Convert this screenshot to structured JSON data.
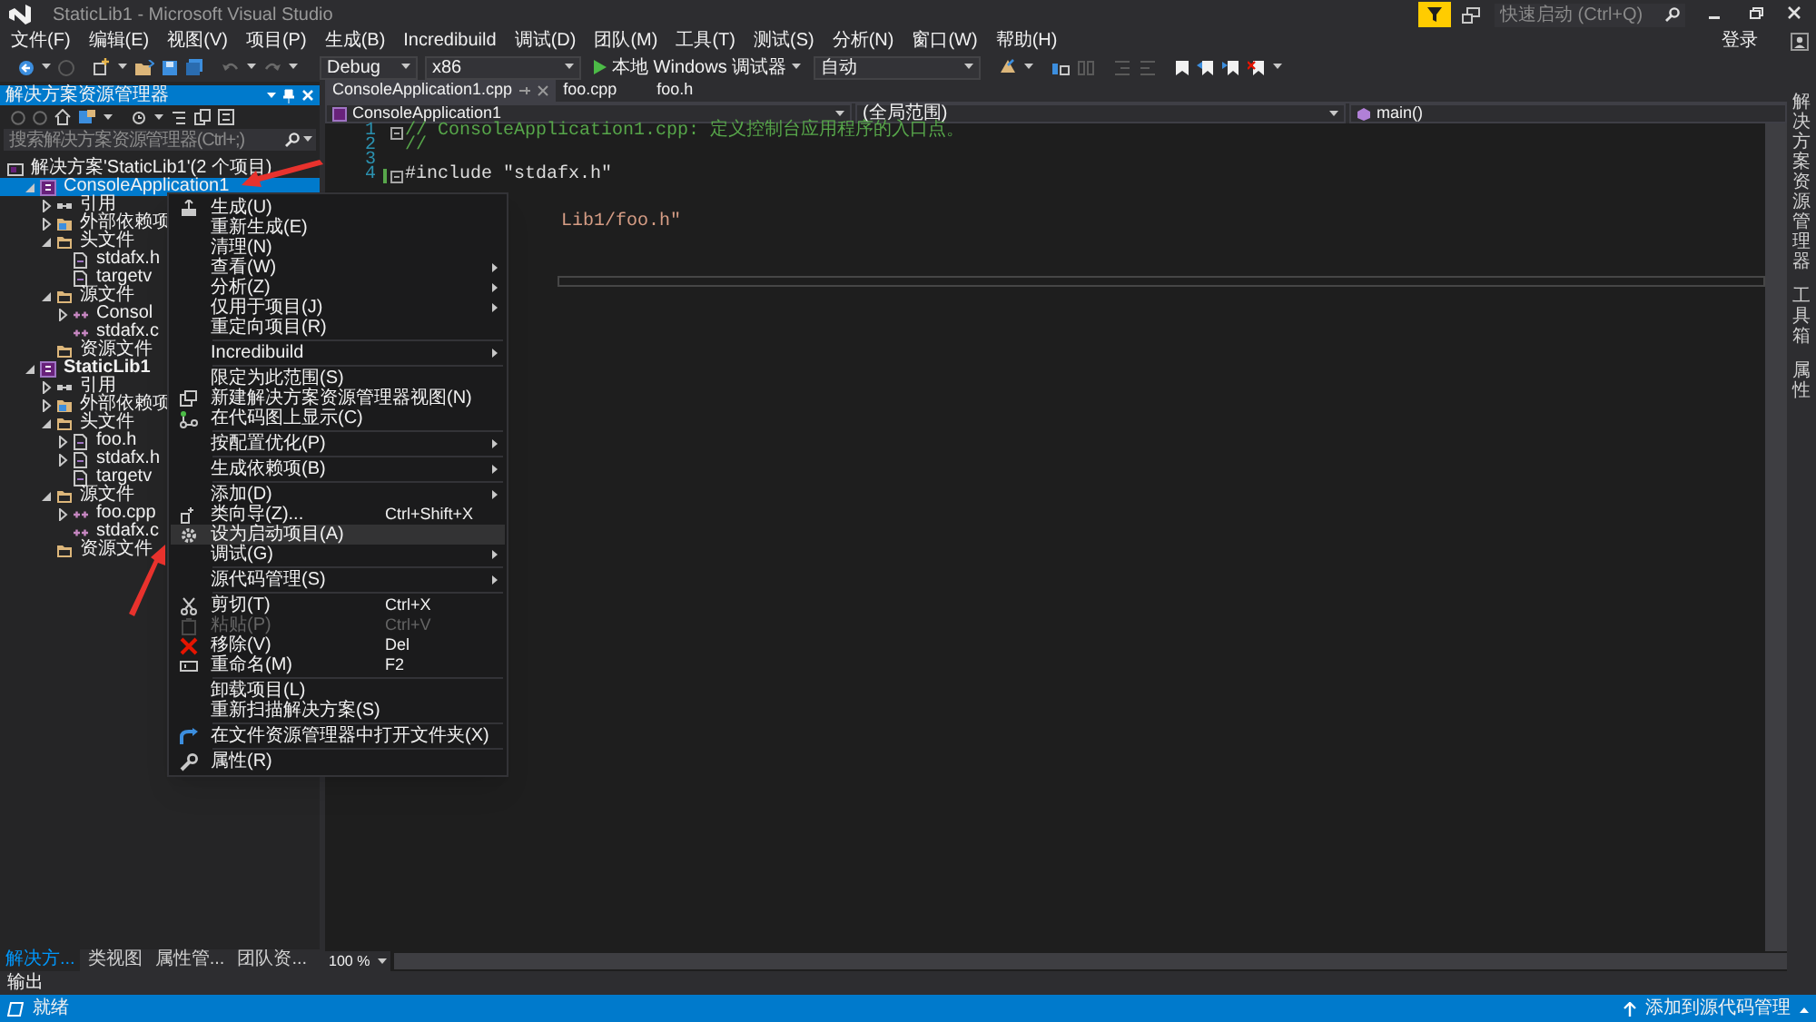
{
  "window": {
    "title": "StaticLib1 - Microsoft Visual Studio"
  },
  "quick_launch": {
    "placeholder": "快速启动 (Ctrl+Q)"
  },
  "menu_bar": [
    "文件(F)",
    "编辑(E)",
    "视图(V)",
    "项目(P)",
    "生成(B)",
    "Incredibuild",
    "调试(D)",
    "团队(M)",
    "工具(T)",
    "测试(S)",
    "分析(N)",
    "窗口(W)",
    "帮助(H)"
  ],
  "sign_in": "登录",
  "toolbar": {
    "configuration": "Debug",
    "platform": "x86",
    "run_button": "本地 Windows 调试器",
    "run_mode": "自动"
  },
  "solution_explorer": {
    "title": "解决方案资源管理器",
    "search": {
      "placeholder": "搜索解决方案资源管理器(Ctrl+;)"
    },
    "tree": [
      {
        "label": "解决方案'StaticLib1'(2 个项目)",
        "kind": "solution",
        "selected": false,
        "children": [
          {
            "label": "ConsoleApplication1",
            "kind": "project",
            "startup": false,
            "expanded": true,
            "selected": true,
            "children": [
              {
                "label": "引用",
                "kind": "references",
                "expanded": false,
                "selected": false
              },
              {
                "label": "外部依赖项",
                "kind": "dependencies",
                "expanded": false,
                "selected": false
              },
              {
                "label": "头文件",
                "kind": "folder",
                "expanded": true,
                "selected": false,
                "children": [
                  {
                    "label": "stdafx.h",
                    "kind": "header",
                    "selected": false
                  },
                  {
                    "label": "targetv",
                    "kind": "header",
                    "selected": false
                  }
                ]
              },
              {
                "label": "源文件",
                "kind": "folder",
                "expanded": true,
                "selected": false,
                "children": [
                  {
                    "label": "Consol",
                    "kind": "source",
                    "expanded": false,
                    "selected": false
                  },
                  {
                    "label": "stdafx.c",
                    "kind": "source",
                    "selected": false
                  }
                ]
              },
              {
                "label": "资源文件",
                "kind": "folder",
                "selected": false
              }
            ]
          },
          {
            "label": "StaticLib1",
            "kind": "project",
            "startup": true,
            "expanded": true,
            "selected": false,
            "children": [
              {
                "label": "引用",
                "kind": "references",
                "expanded": false,
                "selected": false
              },
              {
                "label": "外部依赖项",
                "kind": "dependencies",
                "expanded": false,
                "selected": false
              },
              {
                "label": "头文件",
                "kind": "folder",
                "expanded": true,
                "selected": false,
                "children": [
                  {
                    "label": "foo.h",
                    "kind": "header",
                    "expanded": false,
                    "selected": false
                  },
                  {
                    "label": "stdafx.h",
                    "kind": "header",
                    "expanded": false,
                    "selected": false
                  },
                  {
                    "label": "targetv",
                    "kind": "header",
                    "selected": false
                  }
                ]
              },
              {
                "label": "源文件",
                "kind": "folder",
                "expanded": true,
                "selected": false,
                "children": [
                  {
                    "label": "foo.cpp",
                    "kind": "source",
                    "expanded": false,
                    "selected": false
                  },
                  {
                    "label": "stdafx.c",
                    "kind": "source",
                    "selected": false
                  }
                ]
              },
              {
                "label": "资源文件",
                "kind": "folder",
                "selected": false
              }
            ]
          }
        ]
      }
    ],
    "bottom_tabs": [
      {
        "label": "解决方...",
        "selected": true
      },
      {
        "label": "类视图",
        "selected": false
      },
      {
        "label": "属性管...",
        "selected": false
      },
      {
        "label": "团队资...",
        "selected": false
      }
    ]
  },
  "editor": {
    "tabs": [
      {
        "label": "ConsoleApplication1.cpp",
        "selected": true
      },
      {
        "label": "foo.cpp",
        "selected": false
      },
      {
        "label": "foo.h",
        "selected": false
      }
    ],
    "nav": {
      "project": "ConsoleApplication1",
      "scope": "(全局范围)",
      "member": "main()"
    },
    "lines": [
      {
        "number": "1",
        "text": "// ConsoleApplication1.cpp: 定义控制台应用程序的入口点。",
        "kind": "comment",
        "collapsible": true,
        "changed": false
      },
      {
        "number": "2",
        "text": "//",
        "kind": "comment",
        "collapsible": false,
        "changed": false
      },
      {
        "number": "3",
        "kind": "blank",
        "collapsible": false,
        "changed": false
      },
      {
        "number": "4",
        "text": "#include \"stdafx.h\"",
        "kind": "code",
        "collapsible": true,
        "changed": true
      }
    ],
    "covered_line": {
      "text": "Lib1/foo.h\""
    },
    "zoom": "100 %"
  },
  "context_menu": [
    {
      "kind": "item",
      "label": "生成(U)",
      "submenu": false,
      "disabled": false,
      "selected": false
    },
    {
      "kind": "item",
      "label": "重新生成(E)",
      "submenu": false,
      "disabled": false,
      "selected": false
    },
    {
      "kind": "item",
      "label": "清理(N)",
      "submenu": false,
      "disabled": false,
      "selected": false
    },
    {
      "kind": "item",
      "label": "查看(W)",
      "submenu": true,
      "disabled": false,
      "selected": false
    },
    {
      "kind": "item",
      "label": "分析(Z)",
      "submenu": true,
      "disabled": false,
      "selected": false
    },
    {
      "kind": "item",
      "label": "仅用于项目(J)",
      "submenu": true,
      "disabled": false,
      "selected": false
    },
    {
      "kind": "item",
      "label": "重定向项目(R)",
      "submenu": false,
      "disabled": false,
      "selected": false
    },
    {
      "kind": "separator"
    },
    {
      "kind": "item",
      "label": "Incredibuild",
      "submenu": true,
      "disabled": false,
      "selected": false
    },
    {
      "kind": "separator"
    },
    {
      "kind": "item",
      "label": "限定为此范围(S)",
      "submenu": false,
      "disabled": false,
      "selected": false
    },
    {
      "kind": "item",
      "label": "新建解决方案资源管理器视图(N)",
      "submenu": false,
      "disabled": false,
      "selected": false
    },
    {
      "kind": "item",
      "label": "在代码图上显示(C)",
      "submenu": false,
      "disabled": false,
      "selected": false
    },
    {
      "kind": "separator"
    },
    {
      "kind": "item",
      "label": "按配置优化(P)",
      "submenu": true,
      "disabled": false,
      "selected": false
    },
    {
      "kind": "separator"
    },
    {
      "kind": "item",
      "label": "生成依赖项(B)",
      "submenu": true,
      "disabled": false,
      "selected": false
    },
    {
      "kind": "separator"
    },
    {
      "kind": "item",
      "label": "添加(D)",
      "submenu": true,
      "disabled": false,
      "selected": false
    },
    {
      "kind": "item",
      "label": "类向导(Z)...",
      "shortcut": "Ctrl+Shift+X",
      "submenu": false,
      "disabled": false,
      "selected": false
    },
    {
      "kind": "item",
      "label": "设为启动项目(A)",
      "submenu": false,
      "disabled": false,
      "selected": true
    },
    {
      "kind": "item",
      "label": "调试(G)",
      "submenu": true,
      "disabled": false,
      "selected": false
    },
    {
      "kind": "separator"
    },
    {
      "kind": "item",
      "label": "源代码管理(S)",
      "submenu": true,
      "disabled": false,
      "selected": false
    },
    {
      "kind": "separator"
    },
    {
      "kind": "item",
      "label": "剪切(T)",
      "shortcut": "Ctrl+X",
      "submenu": false,
      "disabled": false,
      "selected": false
    },
    {
      "kind": "item",
      "label": "粘贴(P)",
      "shortcut": "Ctrl+V",
      "submenu": false,
      "disabled": true,
      "selected": false
    },
    {
      "kind": "item",
      "label": "移除(V)",
      "shortcut": "Del",
      "submenu": false,
      "disabled": false,
      "selected": false
    },
    {
      "kind": "item",
      "label": "重命名(M)",
      "shortcut": "F2",
      "submenu": false,
      "disabled": false,
      "selected": false
    },
    {
      "kind": "separator"
    },
    {
      "kind": "item",
      "label": "卸载项目(L)",
      "submenu": false,
      "disabled": false,
      "selected": false
    },
    {
      "kind": "item",
      "label": "重新扫描解决方案(S)",
      "submenu": false,
      "disabled": false,
      "selected": false
    },
    {
      "kind": "separator"
    },
    {
      "kind": "item",
      "label": "在文件资源管理器中打开文件夹(X)",
      "submenu": false,
      "disabled": false,
      "selected": false
    },
    {
      "kind": "separator"
    },
    {
      "kind": "item",
      "label": "属性(R)",
      "submenu": false,
      "disabled": false,
      "selected": false
    }
  ],
  "side_tabs": [
    "解决方案资源管理器",
    "工具箱",
    "属性"
  ],
  "output_label": "输出",
  "status_bar": {
    "text": "就绪",
    "source_control": "添加到源代码管理"
  }
}
